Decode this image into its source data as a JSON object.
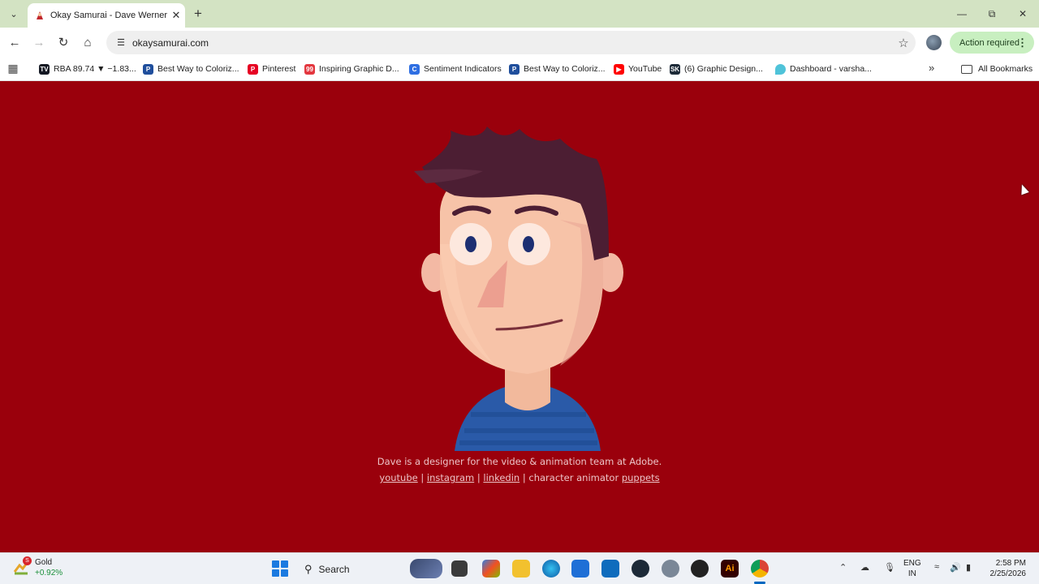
{
  "browser": {
    "tab": {
      "title": "Okay Samurai - Dave Werner"
    },
    "url": "okaysamurai.com",
    "action_button": "Action required",
    "bookmarks": [
      {
        "label": "RBA 89.74 ▼ −1.83...",
        "icon": "tradingview-icon",
        "color": "#131722",
        "glyph": "TV"
      },
      {
        "label": "Best Way to Coloriz...",
        "icon": "paper-icon",
        "color": "#1f4e9c",
        "glyph": "P"
      },
      {
        "label": "Pinterest",
        "icon": "pinterest-icon",
        "color": "#e60023",
        "glyph": "P"
      },
      {
        "label": "Inspiring Graphic D...",
        "icon": "99designs-icon",
        "color": "#e3373f",
        "glyph": "99"
      },
      {
        "label": "Sentiment Indicators",
        "icon": "cnn-icon",
        "color": "#2f6fe2",
        "glyph": "C"
      },
      {
        "label": "Best Way to Coloriz...",
        "icon": "paper-icon",
        "color": "#1f4e9c",
        "glyph": "P"
      },
      {
        "label": "YouTube",
        "icon": "youtube-icon",
        "color": "#ff0000",
        "glyph": "▶"
      },
      {
        "label": "(6) Graphic Design...",
        "icon": "sk-icon",
        "color": "#1d2a38",
        "glyph": "SK"
      },
      {
        "label": "Dashboard - varsha...",
        "icon": "droplet-icon",
        "color": "#4fc3d9",
        "glyph": ""
      }
    ],
    "all_bookmarks": "All Bookmarks"
  },
  "page": {
    "background": "#9a000c",
    "bio": "Dave is a designer for the video & animation team at Adobe.",
    "links": {
      "youtube": "youtube",
      "instagram": "instagram",
      "linkedin": "linkedin",
      "character_animator": "character animator",
      "puppets": "puppets",
      "separator": "|"
    }
  },
  "taskbar": {
    "weather": {
      "name": "Gold",
      "change": "+0.92%",
      "badge": "S"
    },
    "search": "Search",
    "language": {
      "line1": "ENG",
      "line2": "IN"
    },
    "clock": {
      "time": "2:58 PM",
      "date": "2/25/2026"
    }
  }
}
